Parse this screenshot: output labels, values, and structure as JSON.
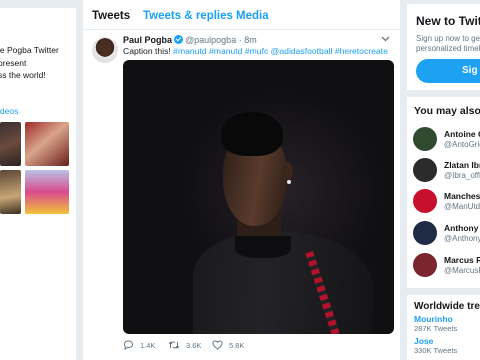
{
  "profile_card": {
    "bio_lines": [
      "le Pogba Twitter",
      "present",
      "ss the world!"
    ],
    "videos_label": "ideos"
  },
  "timeline": {
    "tabs": [
      {
        "label": "Tweets",
        "active": true
      },
      {
        "label": "Tweets & replies",
        "active": false
      },
      {
        "label": "Media",
        "active": false
      }
    ]
  },
  "tweet": {
    "author_name": "Paul Pogba",
    "author_handle": "@paulpogba",
    "separator": "·",
    "time": "8m",
    "text_prefix": "Caption this!",
    "hashtags": [
      "#manutd",
      "#manutd",
      "#mufc",
      "@adidasfootball",
      "#heretocreate"
    ],
    "replies": "1.4K",
    "retweets": "3.6K",
    "likes": "5.8K",
    "menu_icon": "chevron-down-icon"
  },
  "signup_card": {
    "title": "New to Twitt",
    "line1": "Sign up now to get",
    "line2": "personalized timelin",
    "button_label": "Sig"
  },
  "suggestions": {
    "title": "You may also l",
    "people": [
      {
        "name": "Antoine G",
        "handle": "@AntoGrie",
        "avatar_color": "#2f4a2f"
      },
      {
        "name": "Zlatan Ibra",
        "handle": "@Ibra_offic",
        "avatar_color": "#2b2b2b"
      },
      {
        "name": "Manchest",
        "handle": "@ManUtd",
        "avatar_color": "#c8102e"
      },
      {
        "name": "Anthony M",
        "handle": "@AnthonyM",
        "avatar_color": "#1f2a44"
      },
      {
        "name": "Marcus Ra",
        "handle": "@MarcusR",
        "avatar_color": "#7a2530"
      }
    ]
  },
  "trends": {
    "title": "Worldwide tre",
    "items": [
      {
        "name": "Mourinho",
        "count": "287K Tweets"
      },
      {
        "name": "Jose",
        "count": "330K Tweets"
      }
    ]
  },
  "colors": {
    "accent": "#1da1f2",
    "background": "#e6ecf0",
    "text": "#14171a",
    "muted": "#657786"
  }
}
